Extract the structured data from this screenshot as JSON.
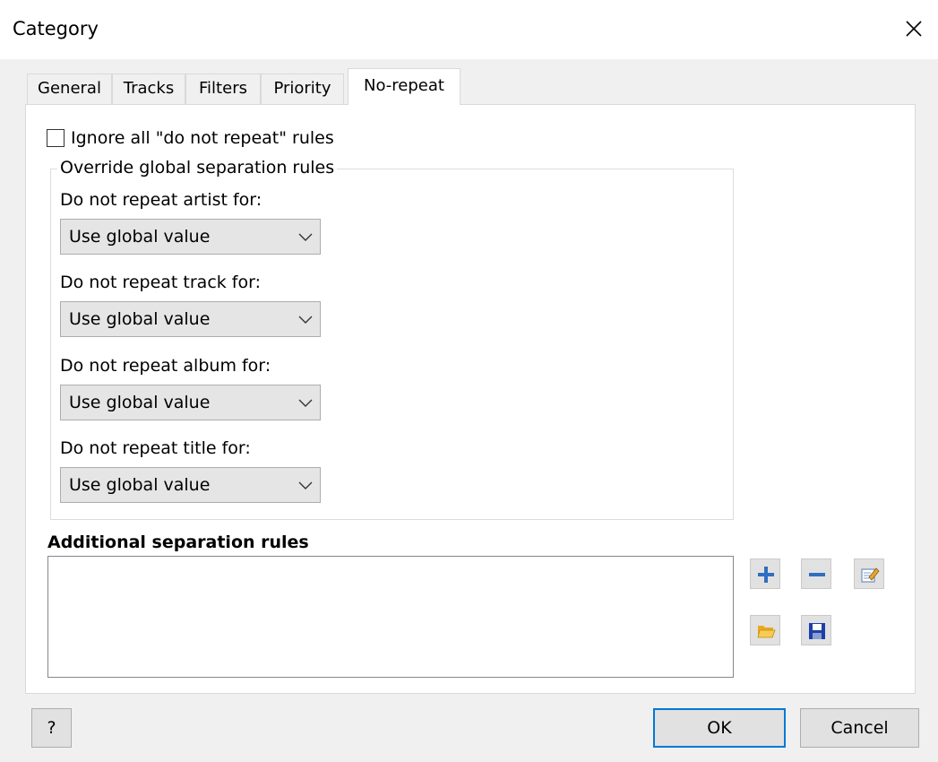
{
  "window": {
    "title": "Category"
  },
  "tabs": [
    {
      "label": "General",
      "active": false
    },
    {
      "label": "Tracks",
      "active": false
    },
    {
      "label": "Filters",
      "active": false
    },
    {
      "label": "Priority",
      "active": false
    },
    {
      "label": "No-repeat",
      "active": true
    }
  ],
  "ignore_rules": {
    "label": "Ignore all \"do not repeat\" rules",
    "checked": false
  },
  "override": {
    "legend": "Override global separation rules",
    "fields": [
      {
        "label": "Do not repeat artist for:",
        "value": "Use global value"
      },
      {
        "label": "Do not repeat track for:",
        "value": "Use global value"
      },
      {
        "label": "Do not repeat album for:",
        "value": "Use global value"
      },
      {
        "label": "Do not repeat title for:",
        "value": "Use global value"
      }
    ]
  },
  "additional": {
    "title": "Additional separation rules",
    "items": [],
    "tools": {
      "add": "plus-icon",
      "remove": "minus-icon",
      "edit": "edit-icon",
      "open": "folder-open-icon",
      "save": "floppy-disk-icon"
    }
  },
  "buttons": {
    "help": "?",
    "ok": "OK",
    "cancel": "Cancel"
  },
  "colors": {
    "accent": "#0078d7",
    "plus": "#2f6fbf",
    "folder": "#f0b428",
    "floppy": "#1f3fa8"
  }
}
